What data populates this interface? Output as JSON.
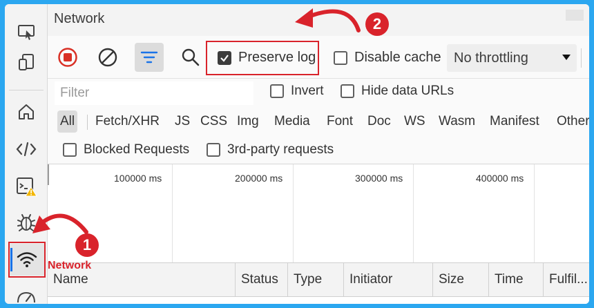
{
  "panel": {
    "title": "Network",
    "brand_text": ""
  },
  "toolbar": {
    "record_label": "Record network log",
    "clear_label": "Clear",
    "filter_toggle_label": "Filter",
    "search_label": "Search",
    "preserve_log": {
      "label": "Preserve log",
      "checked": true
    },
    "disable_cache": {
      "label": "Disable cache",
      "checked": false
    },
    "throttling": {
      "selected": "No throttling"
    }
  },
  "filter_row": {
    "filter_placeholder": "Filter",
    "invert": {
      "label": "Invert",
      "checked": false
    },
    "hide_data_urls": {
      "label": "Hide data URLs",
      "checked": false
    }
  },
  "type_filters": [
    "All",
    "Fetch/XHR",
    "JS",
    "CSS",
    "Img",
    "Media",
    "Font",
    "Doc",
    "WS",
    "Wasm",
    "Manifest",
    "Other"
  ],
  "request_filters": {
    "blocked": {
      "label": "Blocked Requests",
      "checked": false
    },
    "third_party": {
      "label": "3rd-party requests",
      "checked": false
    }
  },
  "overview": {
    "ticks": [
      "100000 ms",
      "200000 ms",
      "300000 ms",
      "400000 ms"
    ]
  },
  "table": {
    "columns": [
      "Name",
      "Status",
      "Type",
      "Initiator",
      "Size",
      "Time",
      "Fulfil..."
    ]
  },
  "annotations": {
    "badge_1": "1",
    "badge_2": "2",
    "network_label": "Network"
  },
  "colors": {
    "background": "#2ba7f0",
    "callout": "#d9232b",
    "record": "#d93025",
    "filter_blue": "#1a73e8"
  },
  "sidebar_icons": [
    "device-emulation-icon",
    "dock-icon",
    "home-icon",
    "elements-icon",
    "console-icon",
    "warning-icon",
    "bug-icon",
    "network-icon",
    "performance-icon"
  ]
}
